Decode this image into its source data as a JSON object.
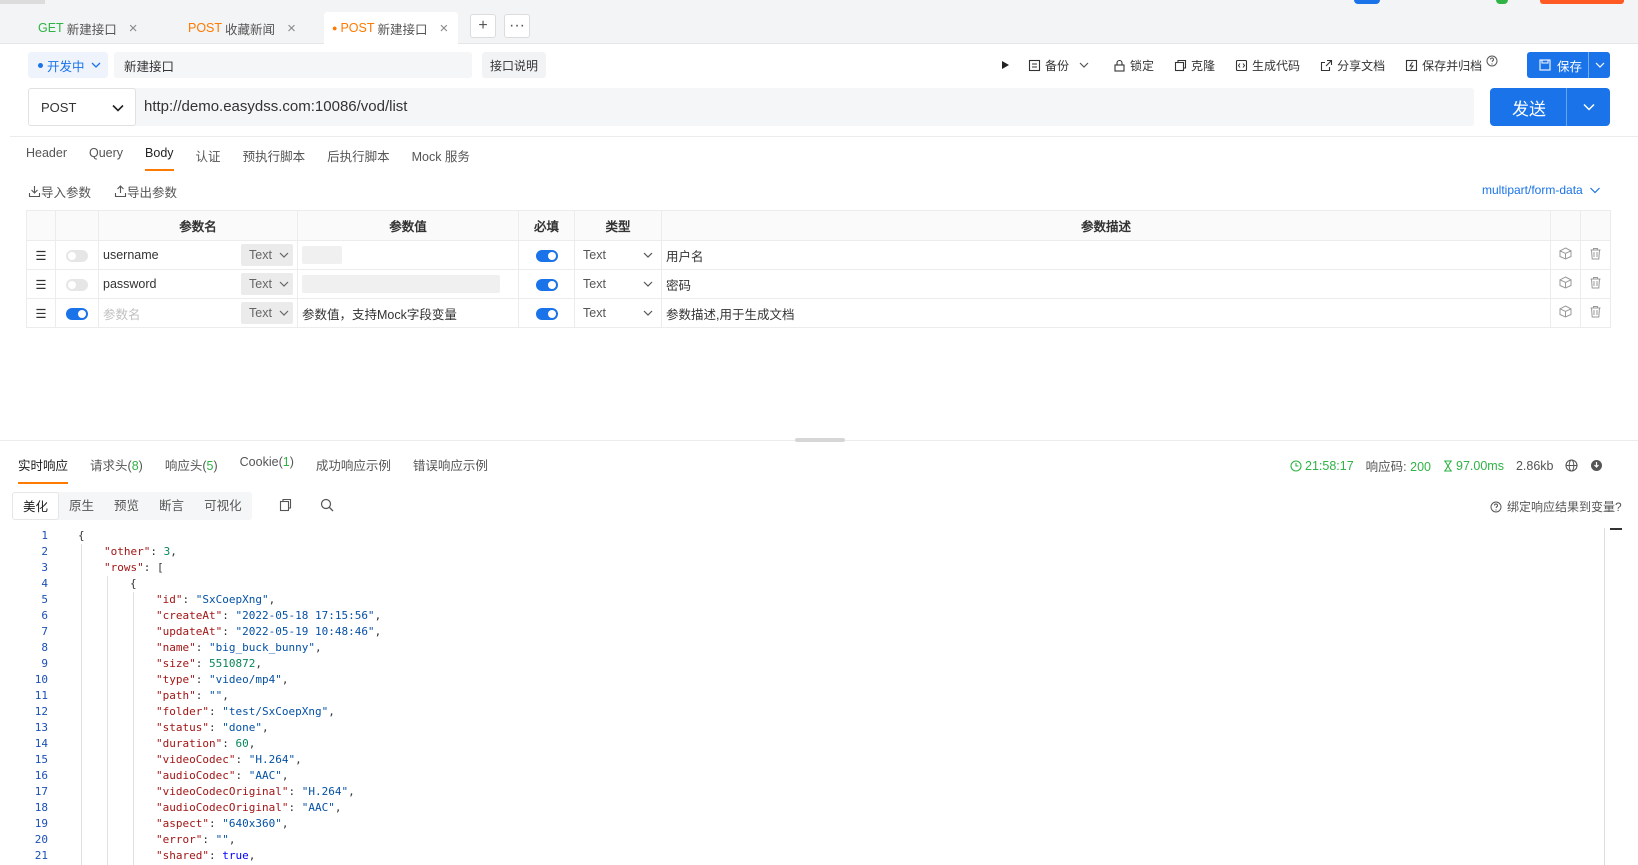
{
  "tabs": [
    {
      "method": "GET",
      "label": "新建接口",
      "close": "×"
    },
    {
      "method": "POST",
      "label": "收藏新闻",
      "close": "×"
    },
    {
      "method": "POST",
      "label": "新建接口",
      "close": "×",
      "active": true,
      "dot": "●"
    }
  ],
  "tab_add": "+",
  "tab_more": "···",
  "status_label": "开发中",
  "api_name": "新建接口",
  "desc_button": "接口说明",
  "toolbar": {
    "backup": "备份",
    "lock": "锁定",
    "clone": "克隆",
    "gen_code": "生成代码",
    "share": "分享文档",
    "save_archive": "保存并归档",
    "save": "保存"
  },
  "request": {
    "method": "POST",
    "url": "http://demo.easydss.com:10086/vod/list",
    "send": "发送"
  },
  "req_tabs": [
    "Header",
    "Query",
    "Body",
    "认证",
    "预执行脚本",
    "后执行脚本",
    "Mock 服务"
  ],
  "import_params": "导入参数",
  "export_params": "导出参数",
  "content_type": "multipart/form-data",
  "params_table": {
    "headers": [
      "参数名",
      "参数值",
      "必填",
      "类型",
      "参数描述"
    ],
    "rows": [
      {
        "name": "username",
        "value_kind": "Text",
        "type": "Text",
        "desc": "用户名"
      },
      {
        "name": "password",
        "value_kind": "Text",
        "type": "Text",
        "desc": "密码"
      }
    ],
    "placeholder_row": {
      "name": "参数名",
      "value": "参数值，支持Mock字段变量",
      "value_kind": "Text",
      "type": "Text",
      "desc": "参数描述,用于生成文档"
    }
  },
  "resp_tabs": [
    {
      "label": "实时响应"
    },
    {
      "label": "请求头",
      "count": "8"
    },
    {
      "label": "响应头",
      "count": "5"
    },
    {
      "label": "Cookie",
      "count": "1"
    },
    {
      "label": "成功响应示例"
    },
    {
      "label": "错误响应示例"
    }
  ],
  "resp_meta": {
    "time": "21:58:17",
    "code_label": "响应码:",
    "code": "200",
    "duration": "97.00ms",
    "size": "2.86kb"
  },
  "fmt_tabs": [
    "美化",
    "原生",
    "预览",
    "断言",
    "可视化"
  ],
  "bind_var": "绑定响应结果到变量?",
  "colors": {
    "accent": "#1a73e8",
    "get": "#2fb344",
    "post": "#ff7a00"
  },
  "code_lines": [
    {
      "n": "1",
      "indent": 0,
      "parts": [
        [
          "p",
          "{"
        ]
      ]
    },
    {
      "n": "2",
      "indent": 1,
      "parts": [
        [
          "k",
          "\"other\""
        ],
        [
          "p",
          ": "
        ],
        [
          "n",
          "3"
        ],
        [
          "p",
          ","
        ]
      ]
    },
    {
      "n": "3",
      "indent": 1,
      "parts": [
        [
          "k",
          "\"rows\""
        ],
        [
          "p",
          ": ["
        ]
      ]
    },
    {
      "n": "4",
      "indent": 2,
      "parts": [
        [
          "p",
          "{"
        ]
      ]
    },
    {
      "n": "5",
      "indent": 3,
      "parts": [
        [
          "k",
          "\"id\""
        ],
        [
          "p",
          ": "
        ],
        [
          "s",
          "\"SxCoepXng\""
        ],
        [
          "p",
          ","
        ]
      ]
    },
    {
      "n": "6",
      "indent": 3,
      "parts": [
        [
          "k",
          "\"createAt\""
        ],
        [
          "p",
          ": "
        ],
        [
          "s",
          "\"2022-05-18 17:15:56\""
        ],
        [
          "p",
          ","
        ]
      ]
    },
    {
      "n": "7",
      "indent": 3,
      "parts": [
        [
          "k",
          "\"updateAt\""
        ],
        [
          "p",
          ": "
        ],
        [
          "s",
          "\"2022-05-19 10:48:46\""
        ],
        [
          "p",
          ","
        ]
      ]
    },
    {
      "n": "8",
      "indent": 3,
      "parts": [
        [
          "k",
          "\"name\""
        ],
        [
          "p",
          ": "
        ],
        [
          "s",
          "\"big_buck_bunny\""
        ],
        [
          "p",
          ","
        ]
      ]
    },
    {
      "n": "9",
      "indent": 3,
      "parts": [
        [
          "k",
          "\"size\""
        ],
        [
          "p",
          ": "
        ],
        [
          "n",
          "5510872"
        ],
        [
          "p",
          ","
        ]
      ]
    },
    {
      "n": "10",
      "indent": 3,
      "parts": [
        [
          "k",
          "\"type\""
        ],
        [
          "p",
          ": "
        ],
        [
          "s",
          "\"video/mp4\""
        ],
        [
          "p",
          ","
        ]
      ]
    },
    {
      "n": "11",
      "indent": 3,
      "parts": [
        [
          "k",
          "\"path\""
        ],
        [
          "p",
          ": "
        ],
        [
          "s",
          "\"\""
        ],
        [
          "p",
          ","
        ]
      ]
    },
    {
      "n": "12",
      "indent": 3,
      "parts": [
        [
          "k",
          "\"folder\""
        ],
        [
          "p",
          ": "
        ],
        [
          "s",
          "\"test/SxCoepXng\""
        ],
        [
          "p",
          ","
        ]
      ]
    },
    {
      "n": "13",
      "indent": 3,
      "parts": [
        [
          "k",
          "\"status\""
        ],
        [
          "p",
          ": "
        ],
        [
          "s",
          "\"done\""
        ],
        [
          "p",
          ","
        ]
      ]
    },
    {
      "n": "14",
      "indent": 3,
      "parts": [
        [
          "k",
          "\"duration\""
        ],
        [
          "p",
          ": "
        ],
        [
          "n",
          "60"
        ],
        [
          "p",
          ","
        ]
      ]
    },
    {
      "n": "15",
      "indent": 3,
      "parts": [
        [
          "k",
          "\"videoCodec\""
        ],
        [
          "p",
          ": "
        ],
        [
          "s",
          "\"H.264\""
        ],
        [
          "p",
          ","
        ]
      ]
    },
    {
      "n": "16",
      "indent": 3,
      "parts": [
        [
          "k",
          "\"audioCodec\""
        ],
        [
          "p",
          ": "
        ],
        [
          "s",
          "\"AAC\""
        ],
        [
          "p",
          ","
        ]
      ]
    },
    {
      "n": "17",
      "indent": 3,
      "parts": [
        [
          "k",
          "\"videoCodecOriginal\""
        ],
        [
          "p",
          ": "
        ],
        [
          "s",
          "\"H.264\""
        ],
        [
          "p",
          ","
        ]
      ]
    },
    {
      "n": "18",
      "indent": 3,
      "parts": [
        [
          "k",
          "\"audioCodecOriginal\""
        ],
        [
          "p",
          ": "
        ],
        [
          "s",
          "\"AAC\""
        ],
        [
          "p",
          ","
        ]
      ]
    },
    {
      "n": "19",
      "indent": 3,
      "parts": [
        [
          "k",
          "\"aspect\""
        ],
        [
          "p",
          ": "
        ],
        [
          "s",
          "\"640x360\""
        ],
        [
          "p",
          ","
        ]
      ]
    },
    {
      "n": "20",
      "indent": 3,
      "parts": [
        [
          "k",
          "\"error\""
        ],
        [
          "p",
          ": "
        ],
        [
          "s",
          "\"\""
        ],
        [
          "p",
          ","
        ]
      ]
    },
    {
      "n": "21",
      "indent": 3,
      "parts": [
        [
          "k",
          "\"shared\""
        ],
        [
          "p",
          ": "
        ],
        [
          "b",
          "true"
        ],
        [
          "p",
          ","
        ]
      ]
    }
  ]
}
